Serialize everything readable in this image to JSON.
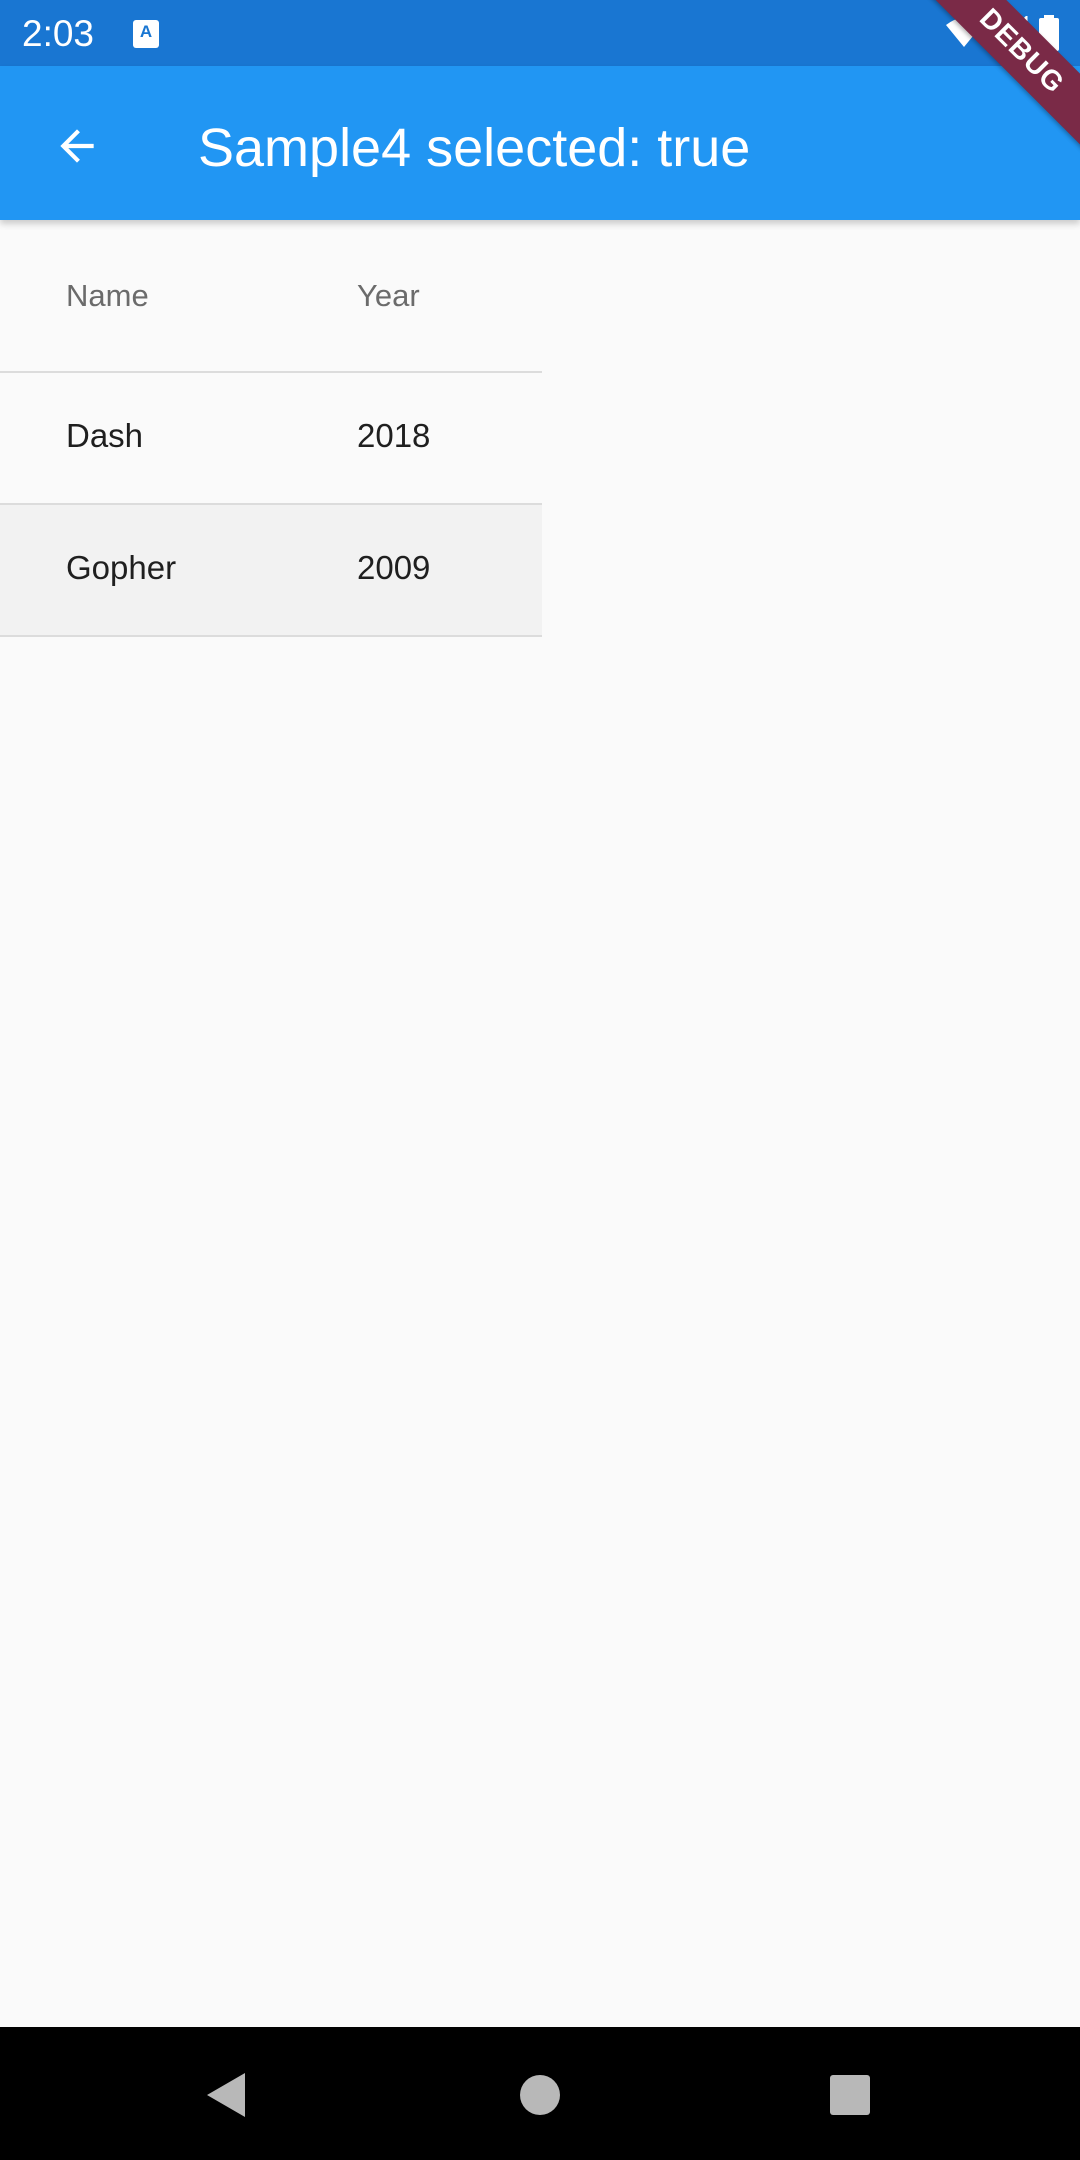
{
  "status_bar": {
    "time": "2:03",
    "notification_icon": "a-text-icon",
    "icons": [
      "wifi-icon",
      "signal-icon",
      "battery-icon"
    ]
  },
  "app_bar": {
    "title": "Sample4 selected: true",
    "back_icon": "arrow-back-icon",
    "color": "#2196f3"
  },
  "debug_banner": "DEBUG",
  "table": {
    "headers": {
      "name": "Name",
      "year": "Year"
    },
    "rows": [
      {
        "name": "Dash",
        "year": "2018",
        "selected": false
      },
      {
        "name": "Gopher",
        "year": "2009",
        "selected": true
      }
    ]
  },
  "nav_bar": {
    "buttons": [
      "back-triangle-icon",
      "home-circle-icon",
      "recents-square-icon"
    ]
  }
}
